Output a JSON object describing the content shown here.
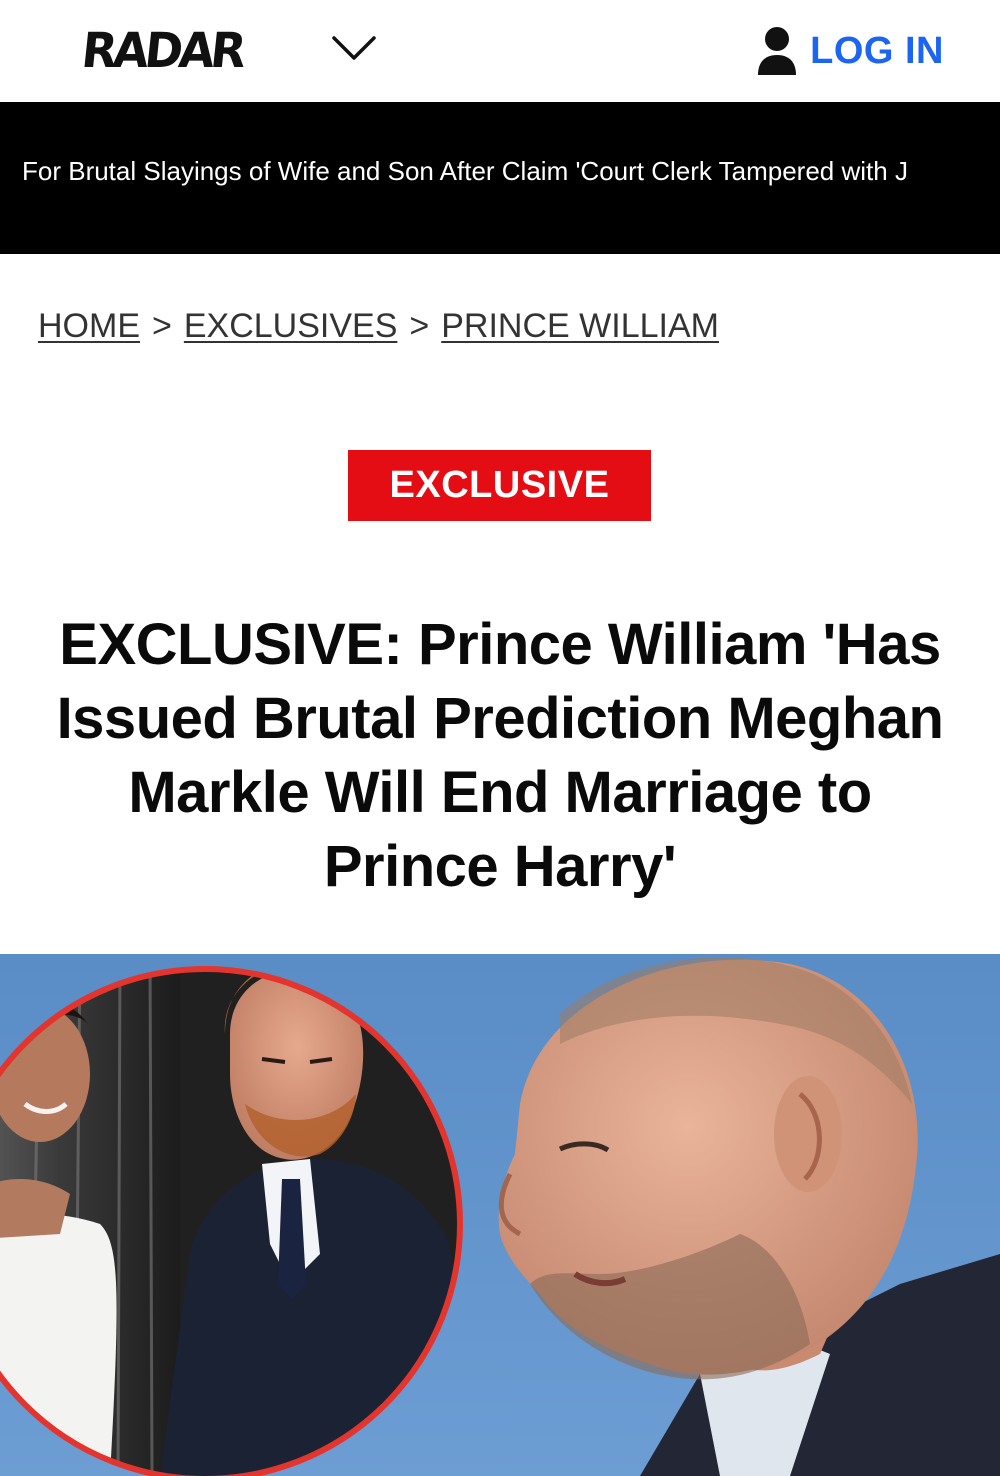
{
  "header": {
    "logo_text": "RADAR",
    "menu_toggle_icon": "chevron-down-icon",
    "login_icon": "user-icon",
    "login_label": "LOG IN",
    "login_color": "#1c64f2"
  },
  "ticker": {
    "text": "For Brutal Slayings of Wife and Son After Claim 'Court Clerk Tampered with J"
  },
  "breadcrumb": {
    "items": [
      "HOME",
      "EXCLUSIVES",
      "PRINCE WILLIAM"
    ],
    "separator": ">"
  },
  "article": {
    "badge": "EXCLUSIVE",
    "badge_color": "#e50d14",
    "headline": "EXCLUSIVE: Prince William 'Has Issued Brutal Prediction Meghan Markle Will End Marriage to Prince Harry'"
  },
  "hero_image": {
    "inset_border_color": "#e3352d",
    "sky_color": "#5f91c9"
  }
}
